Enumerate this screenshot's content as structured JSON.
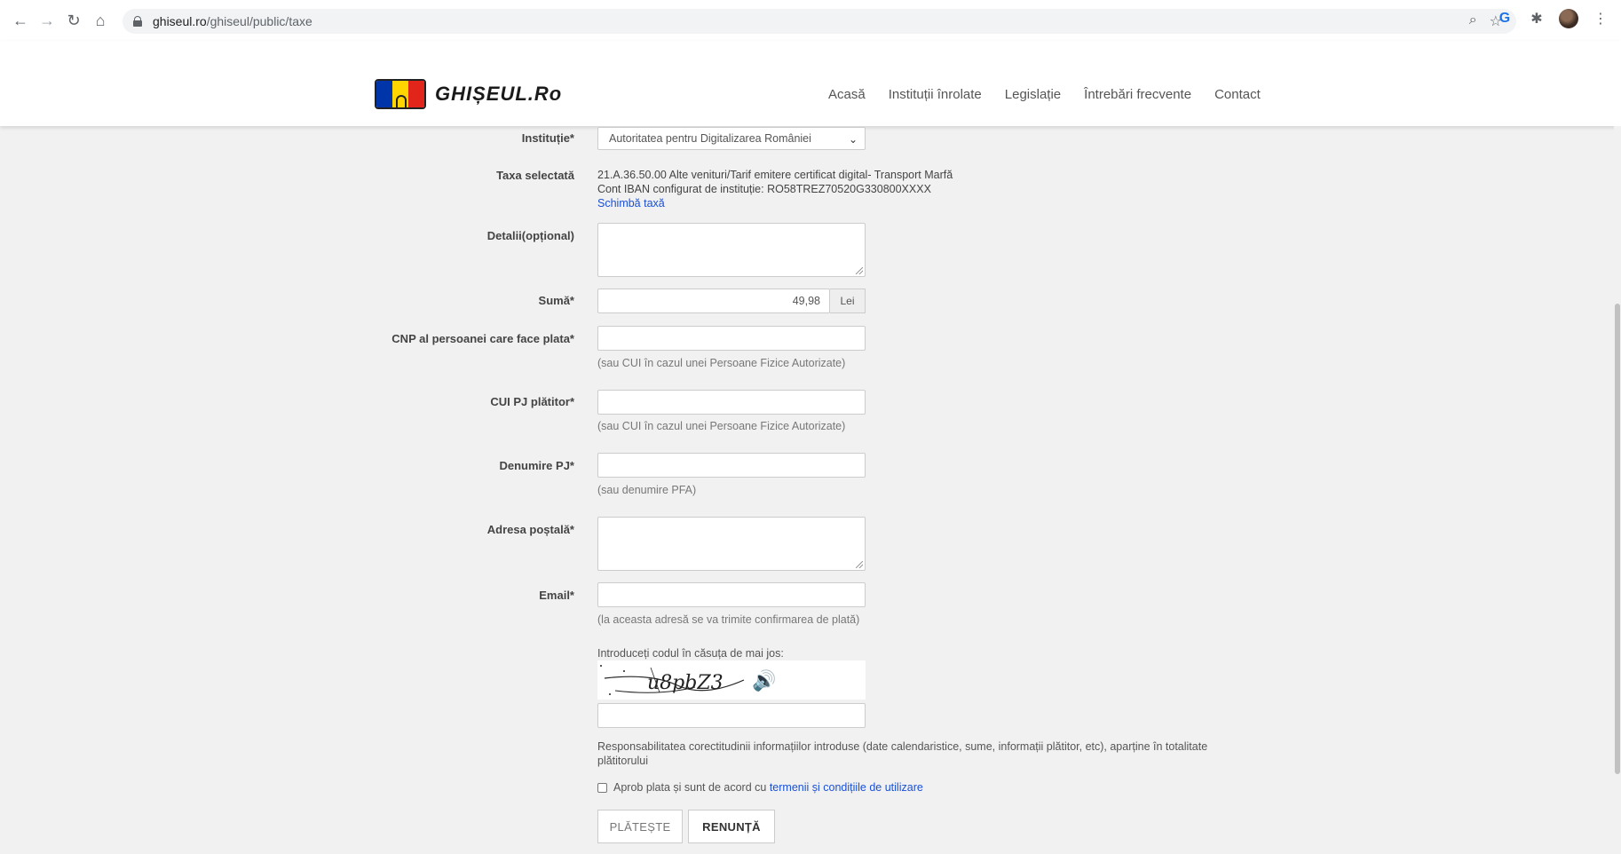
{
  "browser": {
    "url_domain": "ghiseul.ro",
    "url_path": "/ghiseul/public/taxe"
  },
  "site": {
    "logo_text": "GHIȘEUL.Ro",
    "nav": [
      "Acasă",
      "Instituții înrolate",
      "Legislație",
      "Întrebări frecvente",
      "Contact"
    ]
  },
  "form": {
    "institutie_label": "Instituție*",
    "institutie_value": "Autoritatea pentru Digitalizarea României",
    "taxa_label": "Taxa selectată",
    "taxa_line1": "21.A.36.50.00 Alte venituri/Tarif emitere certificat digital- Transport Marfă",
    "taxa_line2": "Cont IBAN configurat de instituție: RO58TREZ70520G330800XXXX",
    "schimba_link": "Schimbă taxă",
    "detalii_label": "Detalii(opțional)",
    "suma_label": "Sumă*",
    "suma_value": "49,98",
    "suma_currency": "Lei",
    "cnp_label": "CNP al persoanei care face plata*",
    "cnp_help": "(sau CUI în cazul unei Persoane Fizice Autorizate)",
    "cui_label": "CUI PJ plătitor*",
    "cui_help": "(sau CUI în cazul unei Persoane Fizice Autorizate)",
    "denumire_label": "Denumire PJ*",
    "denumire_help": "(sau denumire PFA)",
    "adresa_label": "Adresa poștală*",
    "email_label": "Email*",
    "email_help": "(la aceasta adresă se va trimite confirmarea de plată)",
    "captcha_prompt": "Introduceți codul în căsuța de mai jos:",
    "captcha_code": "u8pbZ3",
    "disclaimer": "Responsabilitatea corectitudinii informațiilor introduse (date calendaristice, sume, informații plătitor, etc), aparține în totalitate plătitorului",
    "agree_text": "Aprob plata și sunt de acord cu ",
    "agree_link": "termenii și condițiile de utilizare",
    "btn_pay": "PLĂTEȘTE",
    "btn_cancel": "RENUNȚĂ"
  },
  "icons": {
    "back": "arrow-left",
    "forward": "arrow-right",
    "reload": "reload",
    "home": "home",
    "zoom": "magnifier",
    "bookmark": "star",
    "extensions": "puzzle"
  }
}
